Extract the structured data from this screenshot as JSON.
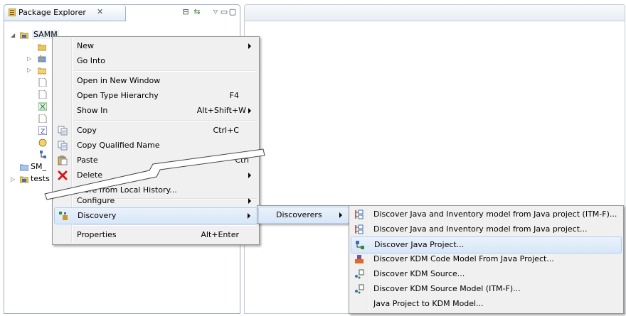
{
  "explorer": {
    "tab_title": "Package Explorer",
    "close_glyph": "✕",
    "toolbar": {
      "collapse": "⊟",
      "link": "⇆",
      "menu": "▽",
      "minimize": "▭",
      "maximize": "▢"
    },
    "tree": {
      "root_label": "SAMM",
      "root_expander": "◢",
      "collapsed_expander": "▷",
      "sibling_label": "SM_",
      "tests_label": "tests"
    }
  },
  "context_menu": {
    "items": [
      {
        "label": "New",
        "shortcut": "",
        "submenu": true
      },
      {
        "label": "Go Into",
        "shortcut": "",
        "submenu": false
      },
      {
        "label": "Open in New Window",
        "shortcut": "",
        "submenu": false
      },
      {
        "label": "Open Type Hierarchy",
        "shortcut": "F4",
        "submenu": false
      },
      {
        "label": "Show In",
        "shortcut": "Alt+Shift+W",
        "submenu": true
      },
      {
        "label": "Copy",
        "shortcut": "Ctrl+C",
        "submenu": false,
        "icon": "copy-icon"
      },
      {
        "label": "Copy Qualified Name",
        "shortcut": "",
        "submenu": false,
        "icon": "copy-qualified-icon"
      },
      {
        "label": "Paste",
        "shortcut": "Ctrl",
        "submenu": false,
        "icon": "paste-icon"
      },
      {
        "label": "Delete",
        "shortcut": "",
        "submenu": true,
        "icon": "delete-icon"
      },
      {
        "label": "...ore from Local History...",
        "shortcut": "",
        "submenu": false
      },
      {
        "label": "Configure",
        "shortcut": "",
        "submenu": true
      },
      {
        "label": "Discovery",
        "shortcut": "",
        "submenu": true,
        "icon": "discovery-icon"
      },
      {
        "label": "Properties",
        "shortcut": "Alt+Enter",
        "submenu": false
      }
    ]
  },
  "discovery_submenu": {
    "items": [
      {
        "label": "Discoverers",
        "submenu": true
      }
    ]
  },
  "discoverers_submenu": {
    "items": [
      {
        "label": "Discover Java and Inventory model from Java project (ITM-F)...",
        "icon": "java-inventory-icon"
      },
      {
        "label": "Discover Java and Inventory model from Java project...",
        "icon": "java-inventory-icon"
      },
      {
        "label": "Discover Java Project...",
        "icon": "java-project-icon"
      },
      {
        "label": "Discover KDM Code Model From Java Project...",
        "icon": "kdm-code-icon"
      },
      {
        "label": "Discover KDM Source...",
        "icon": "kdm-source-icon"
      },
      {
        "label": "Discover KDM Source Model (ITM-F)...",
        "icon": "kdm-source-icon"
      },
      {
        "label": "Java Project to KDM Model...",
        "icon": ""
      }
    ]
  },
  "colors": {
    "highlight": "#d8e6f6",
    "menu_bg": "#f0f0f0",
    "view_border": "#9eb1cb"
  }
}
